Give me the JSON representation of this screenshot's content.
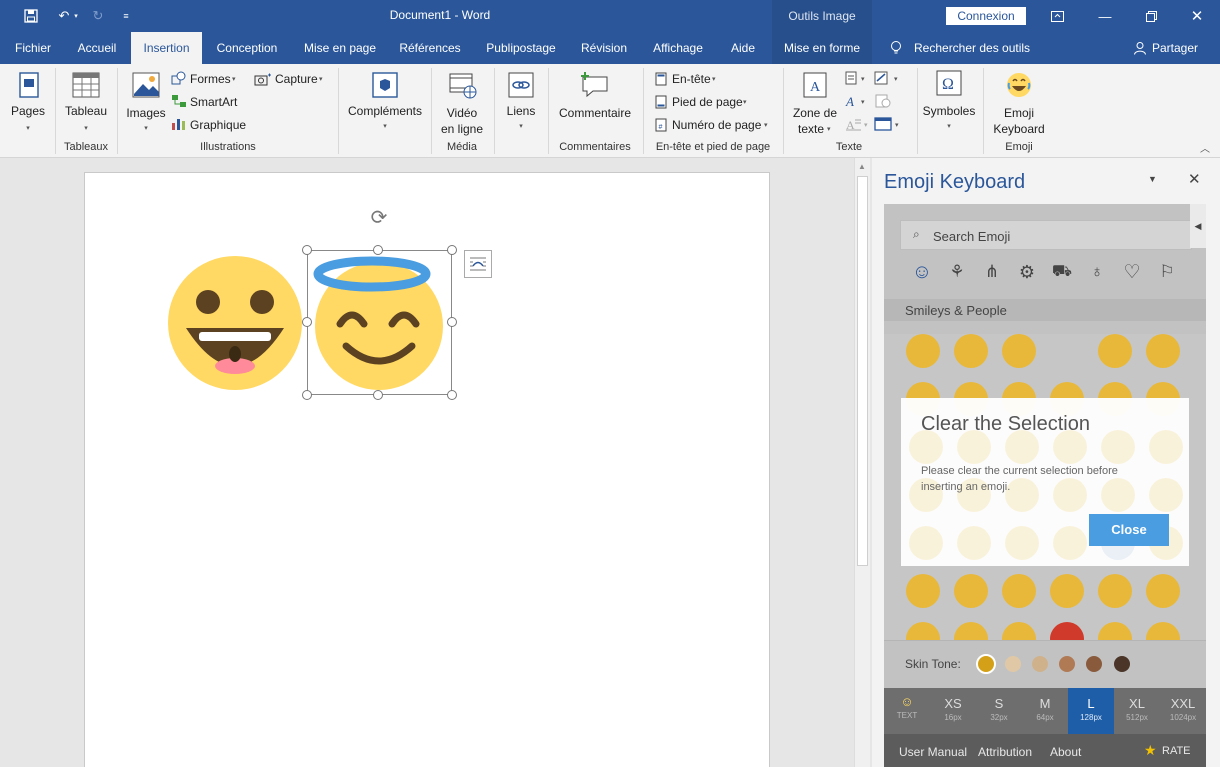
{
  "titlebar": {
    "title": "Document1 - Word",
    "contextual_label": "Outils Image",
    "connexion": "Connexion"
  },
  "tabs": [
    "Fichier",
    "Accueil",
    "Insertion",
    "Conception",
    "Mise en page",
    "Références",
    "Publipostage",
    "Révision",
    "Affichage",
    "Aide",
    "Mise en forme"
  ],
  "active_tab": "Insertion",
  "tell_me": "Rechercher des outils adaptés",
  "share": "Partager",
  "ribbon": {
    "pages": "Pages",
    "tableau": "Tableau",
    "images": "Images",
    "formes": "Formes",
    "smartart": "SmartArt",
    "graphique": "Graphique",
    "capture": "Capture",
    "complements": "Compléments",
    "video1": "Vidéo",
    "video2": "en ligne",
    "liens": "Liens",
    "commentaire": "Commentaire",
    "entete": "En-tête",
    "piedpage": "Pied de page",
    "numpage": "Numéro de page",
    "zone1": "Zone de",
    "zone2": "texte",
    "symboles": "Symboles",
    "emoji1": "Emoji",
    "emoji2": "Keyboard",
    "groups": {
      "tableaux": "Tableaux",
      "illustrations": "Illustrations",
      "media": "Média",
      "commentaires": "Commentaires",
      "entete_pied": "En-tête et pied de page",
      "texte": "Texte",
      "emoji": "Emoji"
    }
  },
  "pane": {
    "title": "Emoji Keyboard",
    "search_placeholder": "Search Emoji",
    "category": "Smileys & People",
    "skin_tone_label": "Skin Tone:",
    "skin_tones": [
      "#d4a017",
      "#e0c8a6",
      "#cfb28c",
      "#b07a55",
      "#8a5a3c",
      "#4a3528"
    ],
    "sizes": [
      {
        "label": "TEXT",
        "sub": ""
      },
      {
        "label": "XS",
        "sub": "16px"
      },
      {
        "label": "S",
        "sub": "32px"
      },
      {
        "label": "M",
        "sub": "64px"
      },
      {
        "label": "L",
        "sub": "128px"
      },
      {
        "label": "XL",
        "sub": "512px"
      },
      {
        "label": "XXL",
        "sub": "1024px"
      }
    ],
    "selected_size": "L",
    "footer": {
      "manual": "User Manual",
      "attribution": "Attribution",
      "about": "About",
      "rate": "RATE"
    },
    "modal": {
      "title": "Clear the Selection",
      "message": "Please clear the current selection before inserting an emoji.",
      "close": "Close"
    }
  },
  "colors": {
    "brand": "#2b579a",
    "emoji_yellow": "#ffd964",
    "halo": "#4a9de0",
    "selected_size": "#1e5ea8"
  }
}
